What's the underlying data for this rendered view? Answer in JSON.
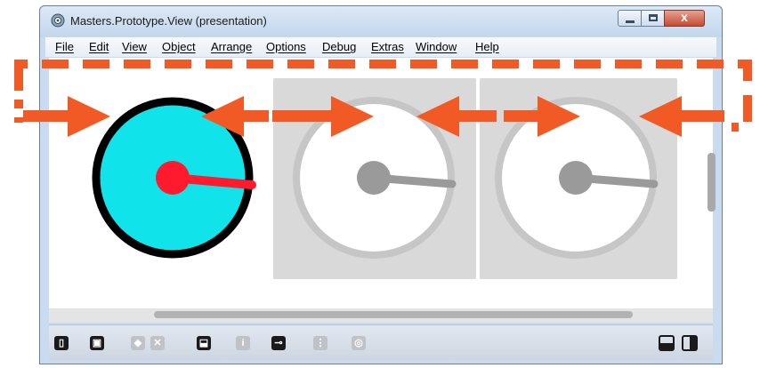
{
  "window": {
    "title": "Masters.Prototype.View (presentation)",
    "close_glyph": "x"
  },
  "menu": [
    {
      "label": "File"
    },
    {
      "label": "Edit"
    },
    {
      "label": "View"
    },
    {
      "label": "Object"
    },
    {
      "label": "Arrange"
    },
    {
      "label": "Options"
    },
    {
      "label": "Debug"
    },
    {
      "label": "Extras"
    },
    {
      "label": "Window"
    },
    {
      "label": "Help"
    }
  ],
  "colors": {
    "active_dial_fill": "#10e4ea",
    "active_dial_ring": "#000000",
    "active_needle": "#ff1a2e",
    "inactive_panel": "#d9d9d9",
    "inactive_ring": "#c6c6c6",
    "inactive_needle": "#9a9a9a",
    "arrow_accent": "#f15a24"
  },
  "toolbar_icons": [
    {
      "name": "lock-icon",
      "enabled": true,
      "glyph": "🔒"
    },
    {
      "name": "bring-front-icon",
      "enabled": true,
      "glyph": "▣"
    },
    {
      "name": "group-icon",
      "enabled": false,
      "glyph": "◆"
    },
    {
      "name": "delete-icon",
      "enabled": false,
      "glyph": "✕"
    },
    {
      "name": "presentation-icon",
      "enabled": true,
      "glyph": "⬓"
    },
    {
      "name": "info-icon",
      "enabled": false,
      "glyph": "i"
    },
    {
      "name": "connector-icon",
      "enabled": true,
      "glyph": "⊸"
    },
    {
      "name": "grid-icon",
      "enabled": false,
      "glyph": "⋮⋮"
    },
    {
      "name": "camera-icon",
      "enabled": false,
      "glyph": "◎"
    }
  ],
  "layout_toggles": [
    {
      "name": "layout-horizontal-icon"
    },
    {
      "name": "layout-vertical-icon"
    }
  ]
}
